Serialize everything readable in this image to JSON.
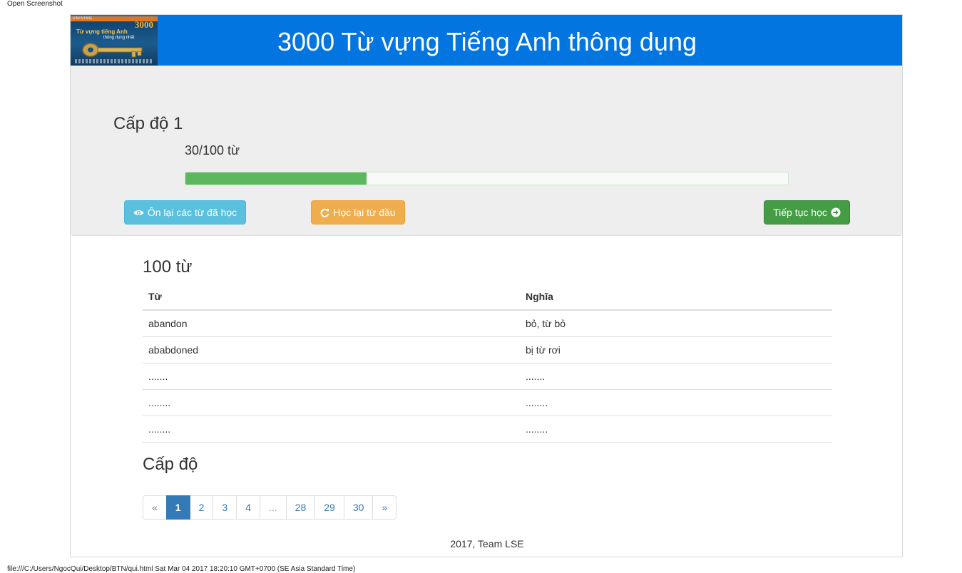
{
  "browser": {
    "top_label": "Open Screenshot",
    "bottom_label": "file:///C:/Users/NgocQui/Desktop/BTN/qui.html Sat Mar 04 2017 18:20:10 GMT+0700 (SE Asia Standard Time)"
  },
  "header": {
    "title": "3000 Từ vựng Tiếng Anh thông dụng",
    "logo": {
      "publisher": "UNIVING",
      "number": "3000",
      "line1": "Từ vựng tiếng Anh",
      "line2": "thông dụng nhất"
    }
  },
  "level_panel": {
    "title": "Cấp độ 1",
    "progress_text": "30/100 từ",
    "progress_value": 0.3,
    "buttons": {
      "review": {
        "label": "Ôn lại các từ đã học",
        "icon": "eye-icon"
      },
      "restart": {
        "label": "Học lại từ đầu",
        "icon": "refresh-icon"
      },
      "next": {
        "label": "Tiếp tục học",
        "icon": "circle-arrow-right-icon"
      }
    }
  },
  "word_list": {
    "title": "100 từ",
    "headers": {
      "word": "Từ",
      "meaning": "Nghĩa"
    },
    "rows": [
      {
        "word": "abandon",
        "meaning": "bỏ, từ bỏ"
      },
      {
        "word": "ababdoned",
        "meaning": "bị từ rơi"
      },
      {
        "word": ".......",
        "meaning": "......."
      },
      {
        "word": "........",
        "meaning": "........"
      },
      {
        "word": "........",
        "meaning": "........"
      }
    ]
  },
  "levels": {
    "title": "Cấp độ",
    "pagination": [
      "«",
      "1",
      "2",
      "3",
      "4",
      "...",
      "28",
      "29",
      "30",
      "»"
    ],
    "active": "1"
  },
  "footer": {
    "text": "2017, Team LSE"
  },
  "colors": {
    "header_bg": "#0275e0",
    "panel_bg": "#eeeeee",
    "progress": "#5cb85c",
    "info": "#5bc0de",
    "warning": "#f0ad4e",
    "success": "#449d44",
    "primary": "#337ab7"
  }
}
